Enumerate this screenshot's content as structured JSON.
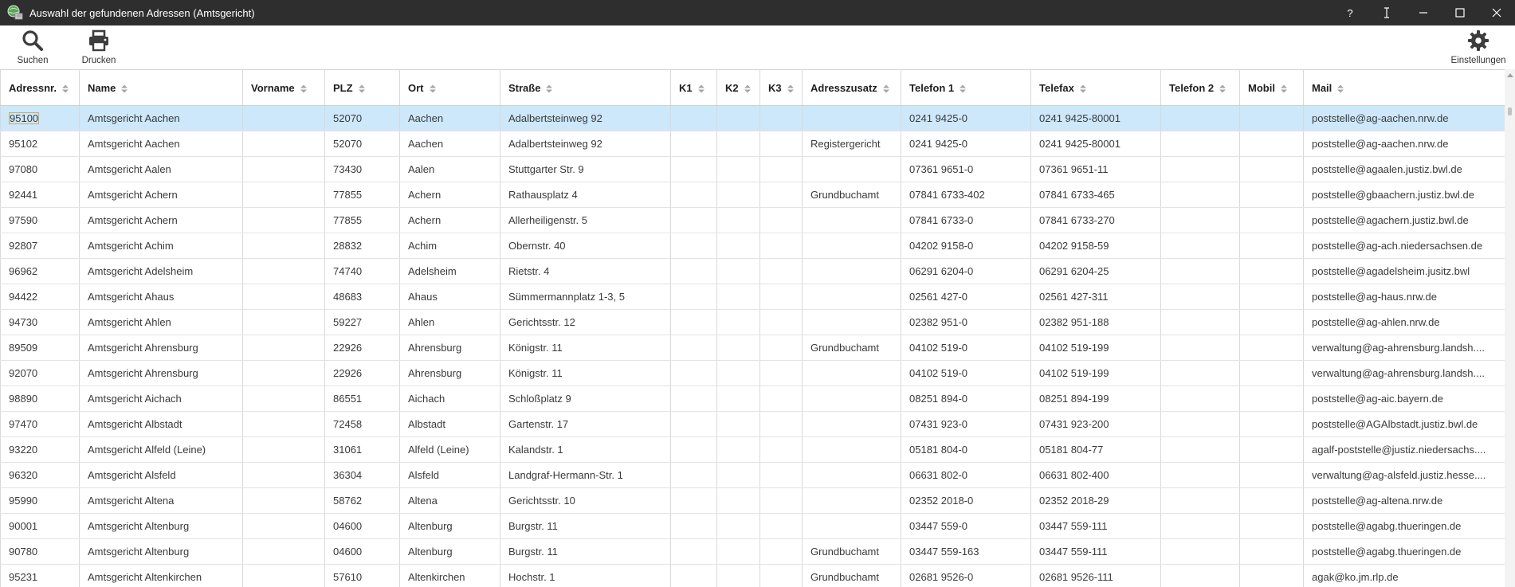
{
  "window": {
    "title": "Auswahl der gefundenen Adressen (Amtsgericht)",
    "help_label": "?"
  },
  "toolbar": {
    "search_label": "Suchen",
    "print_label": "Drucken",
    "settings_label": "Einstellungen"
  },
  "table": {
    "columns": [
      "Adressnr.",
      "Name",
      "Vorname",
      "PLZ",
      "Ort",
      "Straße",
      "K1",
      "K2",
      "K3",
      "Adresszusatz",
      "Telefon 1",
      "Telefax",
      "Telefon 2",
      "Mobil",
      "Mail"
    ],
    "rows": [
      [
        "95100",
        "Amtsgericht Aachen",
        "",
        "52070",
        "Aachen",
        "Adalbertsteinweg 92",
        "",
        "",
        "",
        "",
        "0241 9425-0",
        "0241 9425-80001",
        "",
        "",
        "poststelle@ag-aachen.nrw.de"
      ],
      [
        "95102",
        "Amtsgericht Aachen",
        "",
        "52070",
        "Aachen",
        "Adalbertsteinweg 92",
        "",
        "",
        "",
        "Registergericht",
        "0241 9425-0",
        "0241 9425-80001",
        "",
        "",
        "poststelle@ag-aachen.nrw.de"
      ],
      [
        "97080",
        "Amtsgericht Aalen",
        "",
        "73430",
        "Aalen",
        "Stuttgarter Str. 9",
        "",
        "",
        "",
        "",
        "07361 9651-0",
        "07361 9651-11",
        "",
        "",
        "poststelle@agaalen.justiz.bwl.de"
      ],
      [
        "92441",
        "Amtsgericht Achern",
        "",
        "77855",
        "Achern",
        "Rathausplatz 4",
        "",
        "",
        "",
        "Grundbuchamt",
        "07841 6733-402",
        "07841 6733-465",
        "",
        "",
        "poststelle@gbaachern.justiz.bwl.de"
      ],
      [
        "97590",
        "Amtsgericht Achern",
        "",
        "77855",
        "Achern",
        "Allerheiligenstr. 5",
        "",
        "",
        "",
        "",
        "07841 6733-0",
        "07841 6733-270",
        "",
        "",
        "poststelle@agachern.justiz.bwl.de"
      ],
      [
        "92807",
        "Amtsgericht Achim",
        "",
        "28832",
        "Achim",
        "Obernstr. 40",
        "",
        "",
        "",
        "",
        "04202 9158-0",
        "04202 9158-59",
        "",
        "",
        "poststelle@ag-ach.niedersachsen.de"
      ],
      [
        "96962",
        "Amtsgericht Adelsheim",
        "",
        "74740",
        "Adelsheim",
        "Rietstr. 4",
        "",
        "",
        "",
        "",
        "06291 6204-0",
        "06291 6204-25",
        "",
        "",
        "poststelle@agadelsheim.jusitz.bwl"
      ],
      [
        "94422",
        "Amtsgericht Ahaus",
        "",
        "48683",
        "Ahaus",
        "Sümmermannplatz 1-3, 5",
        "",
        "",
        "",
        "",
        "02561 427-0",
        "02561 427-311",
        "",
        "",
        "poststelle@ag-haus.nrw.de"
      ],
      [
        "94730",
        "Amtsgericht Ahlen",
        "",
        "59227",
        "Ahlen",
        "Gerichtsstr. 12",
        "",
        "",
        "",
        "",
        "02382 951-0",
        "02382 951-188",
        "",
        "",
        "poststelle@ag-ahlen.nrw.de"
      ],
      [
        "89509",
        "Amtsgericht Ahrensburg",
        "",
        "22926",
        "Ahrensburg",
        "Königstr. 11",
        "",
        "",
        "",
        "Grundbuchamt",
        "04102 519-0",
        "04102 519-199",
        "",
        "",
        "verwaltung@ag-ahrensburg.landsh...."
      ],
      [
        "92070",
        "Amtsgericht Ahrensburg",
        "",
        "22926",
        "Ahrensburg",
        "Königstr. 11",
        "",
        "",
        "",
        "",
        "04102 519-0",
        "04102 519-199",
        "",
        "",
        "verwaltung@ag-ahrensburg.landsh...."
      ],
      [
        "98890",
        "Amtsgericht Aichach",
        "",
        "86551",
        "Aichach",
        "Schloßplatz 9",
        "",
        "",
        "",
        "",
        "08251 894-0",
        "08251 894-199",
        "",
        "",
        "poststelle@ag-aic.bayern.de"
      ],
      [
        "97470",
        "Amtsgericht Albstadt",
        "",
        "72458",
        "Albstadt",
        "Gartenstr. 17",
        "",
        "",
        "",
        "",
        "07431 923-0",
        "07431 923-200",
        "",
        "",
        "poststelle@AGAlbstadt.justiz.bwl.de"
      ],
      [
        "93220",
        "Amtsgericht Alfeld (Leine)",
        "",
        "31061",
        "Alfeld (Leine)",
        "Kalandstr. 1",
        "",
        "",
        "",
        "",
        "05181 804-0",
        "05181 804-77",
        "",
        "",
        "agalf-poststelle@justiz.niedersachs...."
      ],
      [
        "96320",
        "Amtsgericht Alsfeld",
        "",
        "36304",
        "Alsfeld",
        "Landgraf-Hermann-Str. 1",
        "",
        "",
        "",
        "",
        "06631 802-0",
        "06631 802-400",
        "",
        "",
        "verwaltung@ag-alsfeld.justiz.hesse...."
      ],
      [
        "95990",
        "Amtsgericht Altena",
        "",
        "58762",
        "Altena",
        "Gerichtsstr. 10",
        "",
        "",
        "",
        "",
        "02352 2018-0",
        "02352 2018-29",
        "",
        "",
        "poststelle@ag-altena.nrw.de"
      ],
      [
        "90001",
        "Amtsgericht Altenburg",
        "",
        "04600",
        "Altenburg",
        "Burgstr. 11",
        "",
        "",
        "",
        "",
        "03447 559-0",
        "03447 559-111",
        "",
        "",
        "poststelle@agabg.thueringen.de"
      ],
      [
        "90780",
        "Amtsgericht Altenburg",
        "",
        "04600",
        "Altenburg",
        "Burgstr. 11",
        "",
        "",
        "",
        "Grundbuchamt",
        "03447 559-163",
        "03447 559-111",
        "",
        "",
        "poststelle@agabg.thueringen.de"
      ],
      [
        "95231",
        "Amtsgericht Altenkirchen",
        "",
        "57610",
        "Altenkirchen",
        "Hochstr. 1",
        "",
        "",
        "",
        "Grundbuchamt",
        "02681 9526-0",
        "02681 9526-111",
        "",
        "",
        "agak@ko.jm.rlp.de"
      ]
    ]
  },
  "colors": {
    "titlebar_bg": "#2e2e2e",
    "selected_row_bg": "#cde8fa",
    "focus_outline": "#c9a96b",
    "grid_line": "#d9d9d9"
  },
  "icons": {
    "app": "globe-app-icon",
    "search": "search-icon",
    "print": "printer-icon",
    "settings": "gear-icon",
    "sort": "sort-arrows-icon"
  }
}
